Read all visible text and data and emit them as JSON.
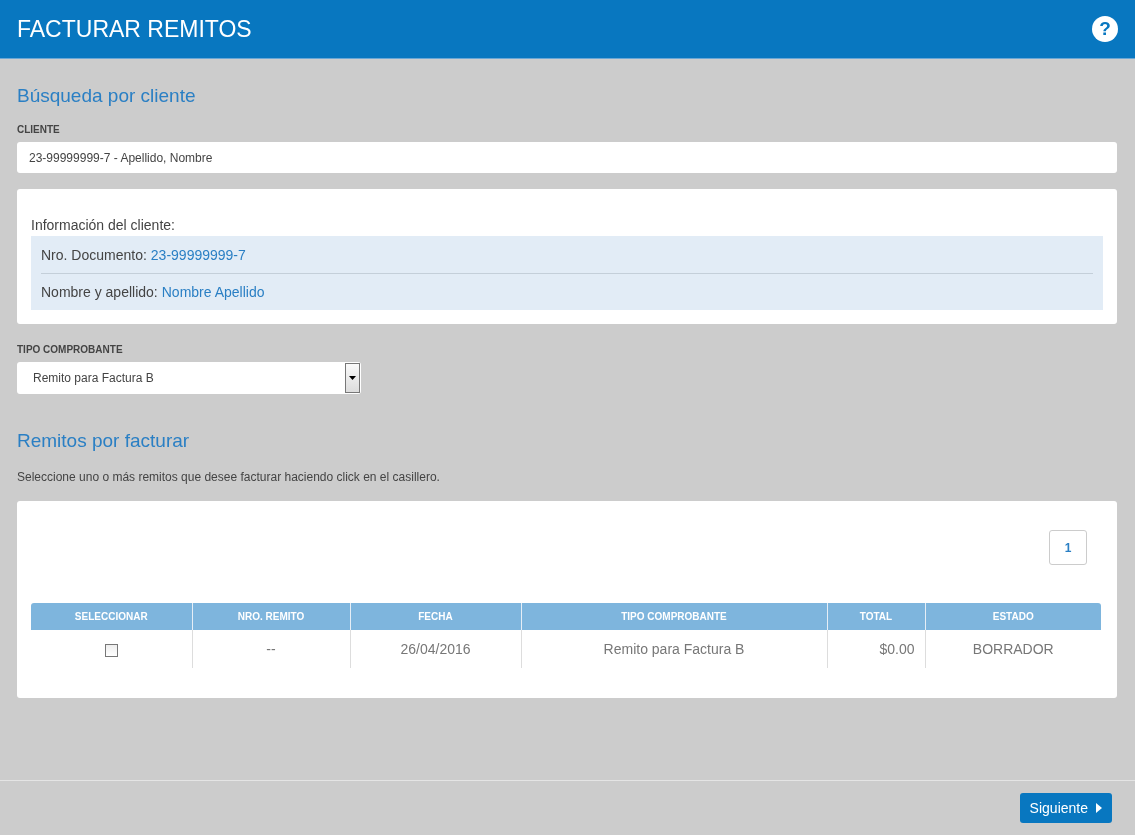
{
  "header": {
    "title": "FACTURAR REMITOS",
    "help_icon": "?"
  },
  "client_search": {
    "heading": "Búsqueda por cliente",
    "field_label": "CLIENTE",
    "value": "23-99999999-7 - Apellido, Nombre"
  },
  "client_info": {
    "title": "Información del cliente:",
    "fields": [
      {
        "label": "Nro. Documento:",
        "value": "23-99999999-7"
      },
      {
        "label": "Nombre y apellido:",
        "value": "Nombre Apellido"
      }
    ]
  },
  "voucher_type": {
    "label": "TIPO COMPROBANTE",
    "value": "Remito para Factura B"
  },
  "remitos": {
    "heading": "Remitos por facturar",
    "hint": "Seleccione uno o más remitos que desee facturar haciendo click en el casillero.",
    "pages": [
      {
        "label": "1",
        "selected": true
      }
    ],
    "table": {
      "columns": [
        "SELECCIONAR",
        "NRO. REMITO",
        "FECHA",
        "TIPO COMPROBANTE",
        "TOTAL",
        "ESTADO"
      ],
      "rows": [
        {
          "checked": false,
          "cells": [
            "",
            "--",
            "26/04/2016",
            "Remito para Factura B",
            "$0.00",
            "BORRADOR"
          ]
        }
      ]
    }
  },
  "footer": {
    "next_button": "Siguiente"
  }
}
